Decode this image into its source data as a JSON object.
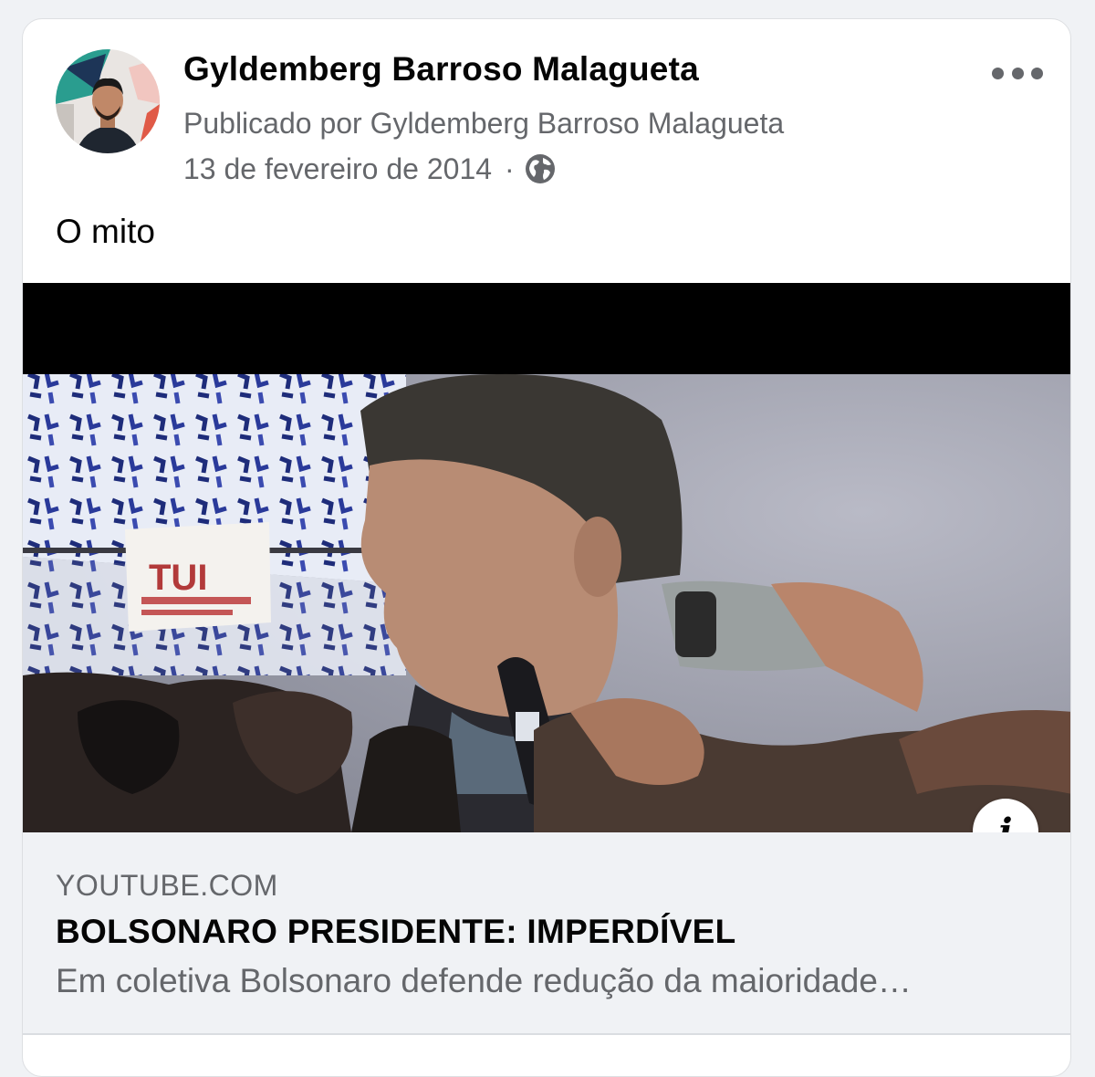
{
  "post": {
    "author_name": "Gyldemberg Barroso Malagueta",
    "published_by": "Publicado por Gyldemberg Barroso Malagueta",
    "date": "13 de fevereiro de 2014",
    "separator": "·",
    "privacy_icon": "globe-icon",
    "more_icon": "more-horizontal-icon",
    "text": "O mito"
  },
  "link_preview": {
    "domain": "YOUTUBE.COM",
    "title": "BOLSONARO PRESIDENTE: IMPERDÍVEL",
    "description": "Em coletiva Bolsonaro defende redução da maioridade…",
    "info_label": "i",
    "info_icon": "info-icon",
    "overlay_sign_text": "TUI"
  },
  "colors": {
    "secondary_text": "#65676b",
    "primary_text": "#050505",
    "preview_background": "#f0f2f5"
  }
}
